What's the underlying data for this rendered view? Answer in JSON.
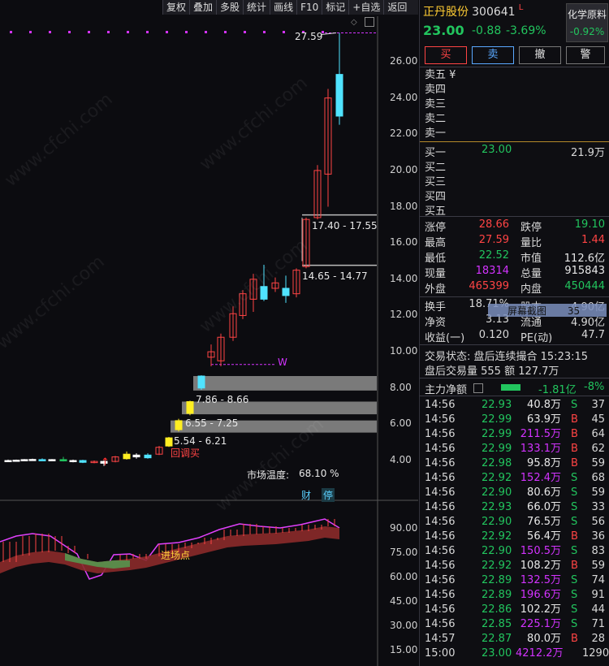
{
  "toolbar": [
    "复权",
    "叠加",
    "多股",
    "统计",
    "画线",
    "F10",
    "标记",
    "+自选",
    "返回"
  ],
  "chart": {
    "y_ticks": [
      "26.00",
      "24.00",
      "22.00",
      "20.00",
      "18.00",
      "16.00",
      "14.00",
      "12.00",
      "10.00",
      "8.00",
      "6.00",
      "4.00"
    ],
    "high_label": "27.59",
    "zone_labels": [
      "17.40 - 17.55",
      "14.65 - 14.77",
      "7.86 - 8.66",
      "6.55 - 7.25",
      "5.54 - 6.21"
    ],
    "w_label": "W",
    "buyback_label": "回调买",
    "market_temp_label": "市场温度:",
    "market_temp_value": "68.10 %",
    "badge_cai": "财",
    "badge_ting": "停",
    "watermark": "www.cfchi.com"
  },
  "indicator": {
    "y_ticks": [
      "90.00",
      "75.00",
      "60.00",
      "45.00",
      "30.00",
      "15.00"
    ],
    "entry_label": "进场点"
  },
  "header": {
    "name": "正丹股份",
    "code": "300641",
    "flag": "L",
    "price": "23.00",
    "change": "-0.88",
    "change_pct": "-3.69%",
    "sector": "化学原料",
    "sector_pct": "-0.92%"
  },
  "trade_buttons": [
    "买",
    "卖",
    "撤",
    "警"
  ],
  "sell_levels": [
    "卖五 ¥",
    "卖四",
    "卖三",
    "卖二",
    "卖一"
  ],
  "buy_levels": [
    {
      "label": "买一",
      "price": "23.00",
      "vol": "21.9万"
    },
    {
      "label": "买二",
      "price": "",
      "vol": ""
    },
    {
      "label": "买三",
      "price": "",
      "vol": ""
    },
    {
      "label": "买四",
      "price": "",
      "vol": ""
    },
    {
      "label": "买五",
      "price": "",
      "vol": ""
    }
  ],
  "stats": [
    {
      "l1": "涨停",
      "v1": "28.66",
      "c1": "red",
      "l2": "跌停",
      "v2": "19.10",
      "c2": "green"
    },
    {
      "l1": "最高",
      "v1": "27.59",
      "c1": "red",
      "l2": "量比",
      "v2": "1.44",
      "c2": "red"
    },
    {
      "l1": "最低",
      "v1": "22.52",
      "c1": "green",
      "l2": "市值",
      "v2": "112.6亿",
      "c2": "white"
    },
    {
      "l1": "现量",
      "v1": "18314",
      "c1": "purple",
      "l2": "总量",
      "v2": "915843",
      "c2": "white"
    },
    {
      "l1": "外盘",
      "v1": "465399",
      "c1": "red",
      "l2": "内盘",
      "v2": "450444",
      "c2": "green"
    }
  ],
  "stats2": [
    {
      "l1": "换手",
      "v1": "18.71%",
      "l2": "股本",
      "v2": "4.90亿"
    },
    {
      "l1": "净资",
      "v1": "3.13",
      "l2": "流通",
      "v2": "4.90亿"
    },
    {
      "l1": "收益(一)",
      "v1": "0.120",
      "l2": "PE(动)",
      "v2": "47.7"
    }
  ],
  "screenshot_overlay": {
    "label": "屏幕截图",
    "num": "35"
  },
  "trade_status": "交易状态: 盘后连续撮合 15:23:15",
  "after_hours": "盘后交易量 555 额 127.7万",
  "net_flow": {
    "label": "主力净额",
    "value": "-1.81亿",
    "pct": "-8%"
  },
  "ticks": [
    {
      "t": "14:56",
      "p": "22.93",
      "v": "40.8万",
      "s": "S",
      "n": "37",
      "vc": "white"
    },
    {
      "t": "14:56",
      "p": "22.99",
      "v": "63.9万",
      "s": "B",
      "n": "45",
      "vc": "white"
    },
    {
      "t": "14:56",
      "p": "22.99",
      "v": "211.5万",
      "s": "B",
      "n": "64",
      "vc": "purple"
    },
    {
      "t": "14:56",
      "p": "22.99",
      "v": "133.1万",
      "s": "B",
      "n": "62",
      "vc": "purple"
    },
    {
      "t": "14:56",
      "p": "22.98",
      "v": "95.8万",
      "s": "B",
      "n": "59",
      "vc": "white"
    },
    {
      "t": "14:56",
      "p": "22.92",
      "v": "152.4万",
      "s": "S",
      "n": "68",
      "vc": "purple"
    },
    {
      "t": "14:56",
      "p": "22.90",
      "v": "80.6万",
      "s": "S",
      "n": "59",
      "vc": "white"
    },
    {
      "t": "14:56",
      "p": "22.93",
      "v": "66.0万",
      "s": "S",
      "n": "33",
      "vc": "white"
    },
    {
      "t": "14:56",
      "p": "22.90",
      "v": "76.5万",
      "s": "S",
      "n": "56",
      "vc": "white"
    },
    {
      "t": "14:56",
      "p": "22.92",
      "v": "56.4万",
      "s": "B",
      "n": "36",
      "vc": "white"
    },
    {
      "t": "14:56",
      "p": "22.90",
      "v": "150.5万",
      "s": "S",
      "n": "83",
      "vc": "purple"
    },
    {
      "t": "14:56",
      "p": "22.92",
      "v": "108.2万",
      "s": "B",
      "n": "59",
      "vc": "white"
    },
    {
      "t": "14:56",
      "p": "22.89",
      "v": "132.5万",
      "s": "S",
      "n": "74",
      "vc": "purple"
    },
    {
      "t": "14:56",
      "p": "22.89",
      "v": "196.6万",
      "s": "S",
      "n": "91",
      "vc": "purple"
    },
    {
      "t": "14:56",
      "p": "22.86",
      "v": "102.2万",
      "s": "S",
      "n": "44",
      "vc": "white"
    },
    {
      "t": "14:56",
      "p": "22.85",
      "v": "225.1万",
      "s": "S",
      "n": "71",
      "vc": "purple"
    },
    {
      "t": "14:57",
      "p": "22.87",
      "v": "80.0万",
      "s": "B",
      "n": "28",
      "vc": "white"
    },
    {
      "t": "15:00",
      "p": "23.00",
      "v": "4212.2万",
      "s": "",
      "n": "1290",
      "vc": "purple"
    }
  ]
}
